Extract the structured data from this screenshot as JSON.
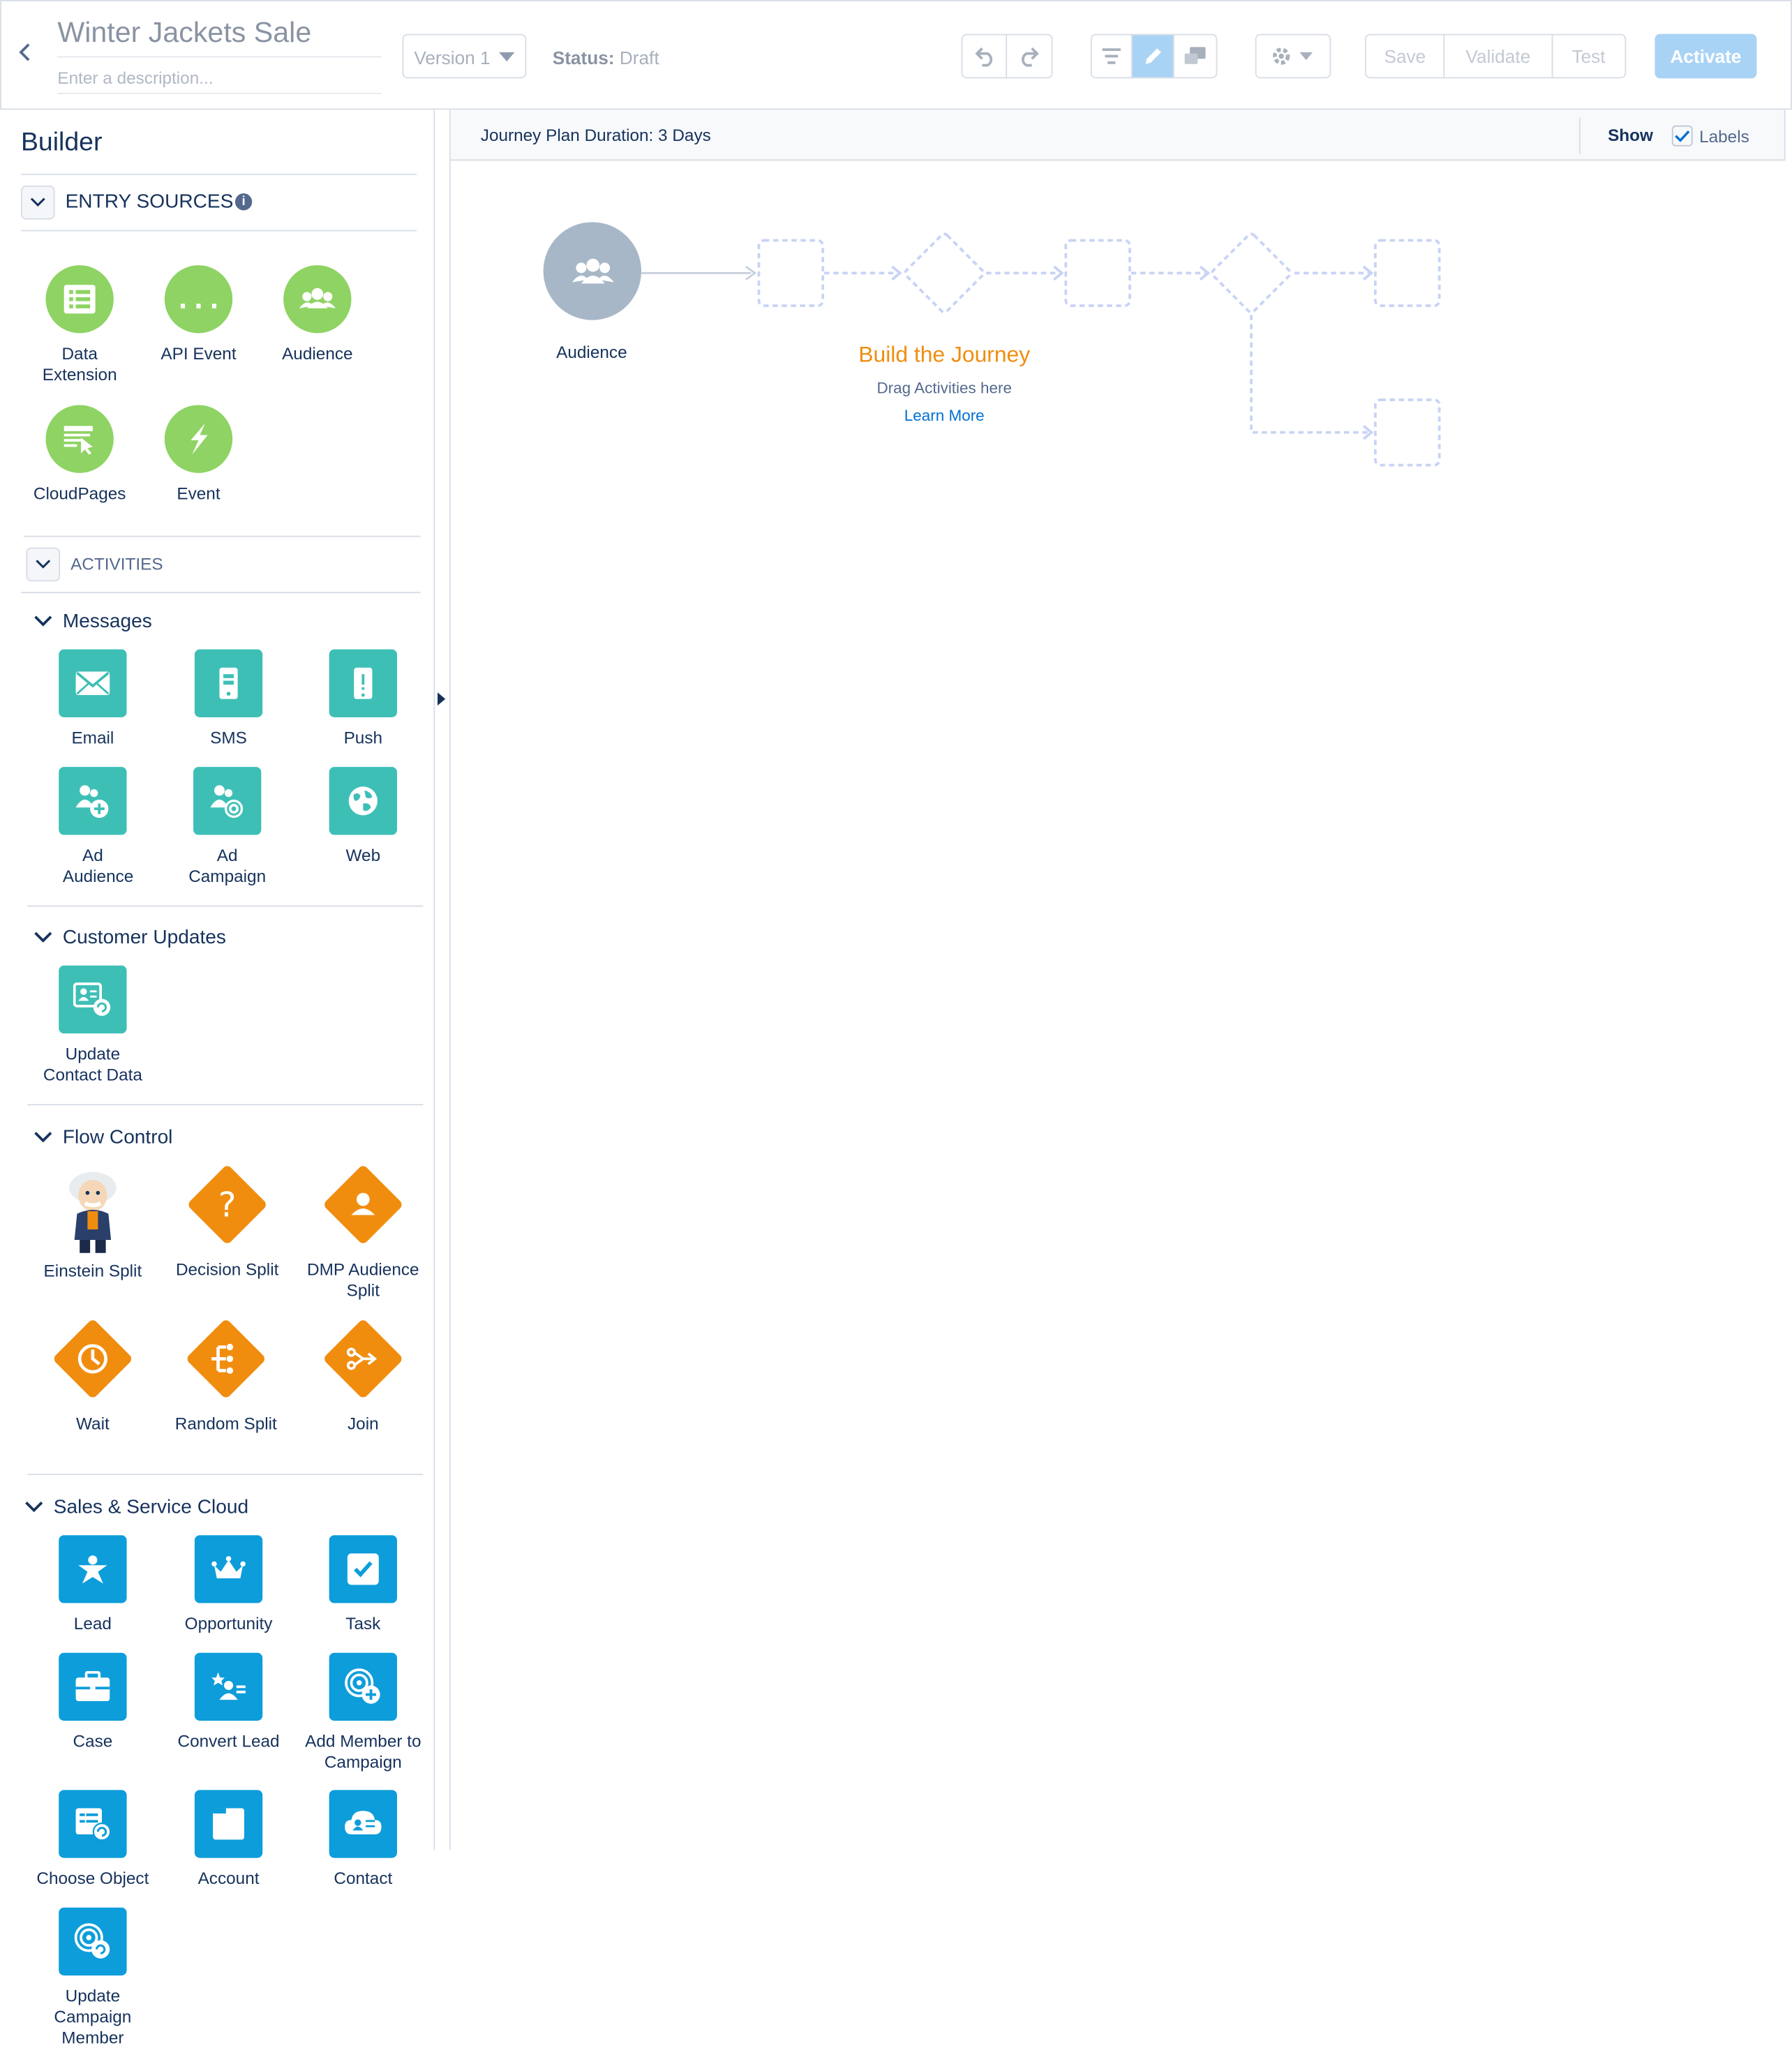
{
  "header": {
    "back_icon": "chevron-left-icon",
    "journey_name": "Winter Jackets Sale",
    "description_placeholder": "Enter a description...",
    "version": "Version 1",
    "status_label": "Status:",
    "status_value": "Draft",
    "undo_icon": "undo-icon",
    "redo_icon": "redo-icon",
    "view_icons": [
      "filter-icon",
      "pencil-icon",
      "comments-icon"
    ],
    "settings_icon": "gear-icon",
    "save": "Save",
    "validate": "Validate",
    "test": "Test",
    "activate": "Activate"
  },
  "sidebar": {
    "title": "Builder",
    "entry_sources": {
      "label": "ENTRY SOURCES",
      "items": [
        {
          "label": "Data Extension",
          "icon": "table-icon"
        },
        {
          "label": "API Event",
          "icon": "braces-icon"
        },
        {
          "label": "Audience",
          "icon": "people-icon"
        },
        {
          "label": "CloudPages",
          "icon": "cloudpages-icon"
        },
        {
          "label": "Event",
          "icon": "bolt-icon"
        }
      ]
    },
    "activities": {
      "label": "ACTIVITIES",
      "messages": {
        "label": "Messages",
        "items": [
          {
            "label": "Email",
            "icon": "email-icon"
          },
          {
            "label": "SMS",
            "icon": "phone-icon"
          },
          {
            "label": "Push",
            "icon": "push-icon"
          },
          {
            "label": "Ad Audience",
            "icon": "ad-audience-icon"
          },
          {
            "label": "Ad Campaign",
            "icon": "ad-campaign-icon"
          },
          {
            "label": "Web",
            "icon": "globe-icon"
          }
        ]
      },
      "customer_updates": {
        "label": "Customer Updates",
        "items": [
          {
            "label": "Update Contact Data",
            "icon": "update-contact-icon"
          }
        ]
      },
      "flow_control": {
        "label": "Flow Control",
        "items": [
          {
            "label": "Einstein Split",
            "icon": "einstein-icon"
          },
          {
            "label": "Decision Split",
            "icon": "question-icon"
          },
          {
            "label": "DMP Audience Split",
            "icon": "person-icon"
          },
          {
            "label": "Wait",
            "icon": "clock-icon"
          },
          {
            "label": "Random Split",
            "icon": "split-icon"
          },
          {
            "label": "Join",
            "icon": "join-icon"
          }
        ]
      },
      "sales_service": {
        "label": "Sales & Service Cloud",
        "items": [
          {
            "label": "Lead",
            "icon": "lead-icon"
          },
          {
            "label": "Opportunity",
            "icon": "crown-icon"
          },
          {
            "label": "Task",
            "icon": "checkbox-icon"
          },
          {
            "label": "Case",
            "icon": "briefcase-icon"
          },
          {
            "label": "Convert Lead",
            "icon": "convert-lead-icon"
          },
          {
            "label": "Add Member to Campaign",
            "icon": "add-campaign-member-icon"
          },
          {
            "label": "Choose Object",
            "icon": "choose-object-icon"
          },
          {
            "label": "Account",
            "icon": "account-icon"
          },
          {
            "label": "Contact",
            "icon": "contact-icon"
          },
          {
            "label": "Update Campaign Member",
            "icon": "update-campaign-member-icon"
          }
        ]
      }
    }
  },
  "canvas": {
    "duration": "Journey Plan Duration: 3 Days",
    "show": "Show",
    "labels": "Labels",
    "labels_checked": true,
    "entry_node_label": "Audience",
    "build_title": "Build the Journey",
    "drag_hint": "Drag Activities here",
    "learn_more": "Learn More"
  },
  "colors": {
    "entry_green": "#8ed363",
    "message_teal": "#3ebfb6",
    "flow_orange": "#f08d0f",
    "sales_blue": "#0d9dda",
    "activate_blue": "#a9d3f5",
    "link_blue": "#0070d2"
  }
}
